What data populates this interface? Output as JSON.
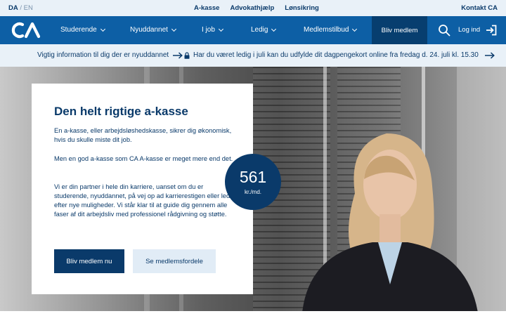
{
  "topbar": {
    "lang_active": "DA",
    "lang_sep": " / ",
    "lang_other": "EN",
    "links": [
      "A-kasse",
      "Advokathjælp",
      "Lønsikring"
    ],
    "contact": "Kontakt CA"
  },
  "nav": {
    "items": [
      "Studerende",
      "Nyuddannet",
      "I job",
      "Ledig",
      "Medlemstilbud"
    ],
    "cta": "Bliv medlem",
    "login": "Log ind",
    "accent": "#0d5fa5"
  },
  "infobar": {
    "left": "Vigtig information til dig der er nyuddannet",
    "right": "Har du været ledig i juli kan du udfylde dit dagpengekort online fra fredag d. 24. juli kl. 15.30"
  },
  "hero": {
    "title": "Den helt rigtige a-kasse",
    "paragraphs": [
      "En a-kasse, eller arbejdsløshedskasse, sikrer dig økonomisk, hvis du skulle miste dit job.",
      "Men en god a-kasse som CA A-kasse er meget mere end det.",
      "Vi er din partner i hele din karriere, uanset om du er studerende, nyuddannet, på vej op ad karrierestigen eller leder efter nye muligheder. Vi står klar til at guide dig gennem alle faser af dit arbejdsliv med professionel rådgivning og støtte."
    ],
    "primary_button": "Bliv medlem nu",
    "secondary_button": "Se medlemsfordele",
    "price": "561",
    "price_unit": "kr./md."
  }
}
